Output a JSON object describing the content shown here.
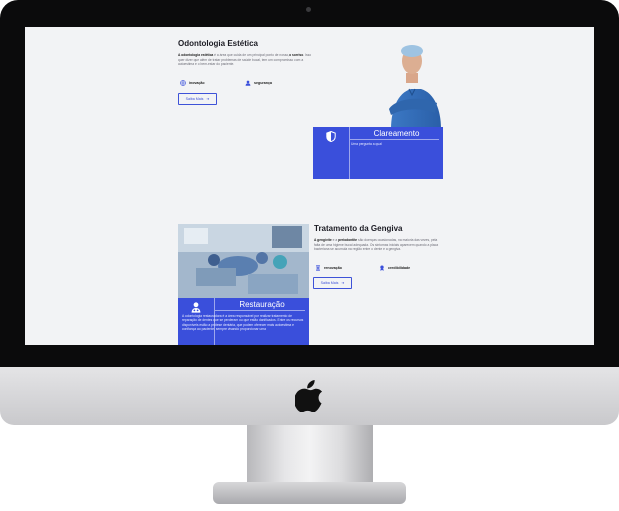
{
  "section1": {
    "title": "Odontologia Estética",
    "paragraph_bold1": "A odontologia estética",
    "paragraph_text1": " é a área que cuida de um principal ponto de nosso,",
    "paragraph_bold2": "o sorriso",
    "paragraph_text2": ". Isso quer dizer que além de tratar problemas de saúde bucal, tem um compromisso com a autoestima e o bem-estar do paciente.",
    "feature1": "inovação",
    "feature2": "segurança",
    "button": "Saiba Mais",
    "card": {
      "title": "Clareamento",
      "text": "Uma pergunta a qual "
    }
  },
  "section2": {
    "title": "Tratamento da Gengiva",
    "paragraph_bold1": "A gengivite",
    "paragraph_text1": " e a ",
    "paragraph_bold2": "periodontite",
    "paragraph_text2": " são doenças ocasionadas, na maioria das vezes, pela falta de uma higiene bucal adequada. Os sintomas iniciais aparecem quando a placa bacteriana se acumula na região entre o dente e a gengiva.",
    "feature1": "renovação",
    "feature2": "credibilidade",
    "button": "Saiba Mais",
    "card": {
      "title": "Restauração",
      "text": "A odontologia restauradora é a área responsável por realizar tratamento de reparação de dentes que se perderam ou que estão danificados. Entre os recursos disponíveis estão a prótese dentária, que podem oferecer mais autoestima e confiança ao paciente, sempre visando proporcionar uma"
    }
  },
  "colors": {
    "accent": "#3a4fdb",
    "screen_bg": "#f2f3f5",
    "bezel": "#0b0b0c"
  }
}
